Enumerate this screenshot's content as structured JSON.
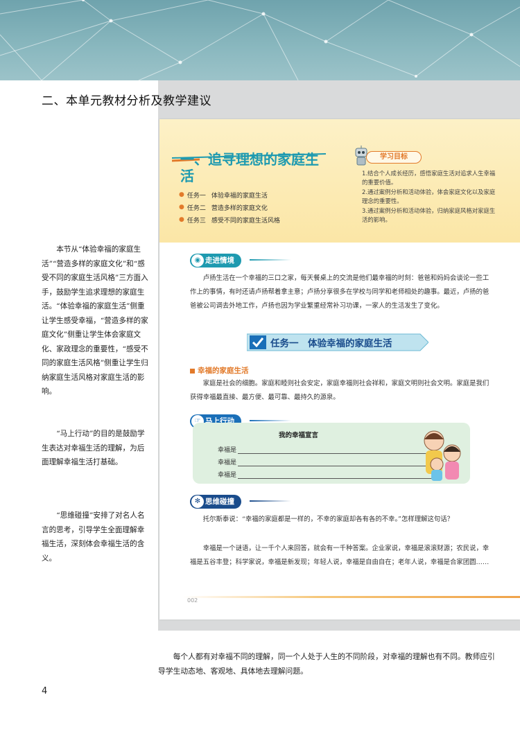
{
  "section_title": "二、本单元教材分析及教学建议",
  "textbook": {
    "lesson_title": "一、追寻理想的家庭生活",
    "tasks": [
      {
        "num": "任务一",
        "label": "体验幸福的家庭生活"
      },
      {
        "num": "任务二",
        "label": "营造多样的家庭文化"
      },
      {
        "num": "任务三",
        "label": "感受不同的家庭生活风格"
      }
    ],
    "goals_label": "学习目标",
    "goals": [
      "1.结合个人成长经历，感悟家庭生活对追求人生幸福的重要价值。",
      "2.通过案例分析和活动体验，体会家庭文化以及家庭理念的重要性。",
      "3.通过案例分析和活动体验，归纳家庭风格对家庭生活的影响。"
    ],
    "intro_badge": "走进情境",
    "intro_text": "卢扬生活在一个幸福的三口之家，每天餐桌上的交流是他们最幸福的时刻：爸爸和妈妈会谈论一些工作上的事情，有时还请卢扬帮着拿主意；卢扬分享很多在学校与同学和老师相处的趣事。最近，卢扬的爸爸被公司调去外地工作，卢扬也因为学业繁重经常补习功课，一家人的生活发生了变化。",
    "task_banner": "任务一　体验幸福的家庭生活",
    "subhead": "幸福的家庭生活",
    "para1": "家庭是社会的细胞。家庭和睦则社会安定，家庭幸福则社会祥和，家庭文明则社会文明。家庭是我们获得幸福最直接、最方便、最可靠、最持久的源泉。",
    "action_badge": "马上行动",
    "box_title": "我的幸福宣言",
    "fill_label": "幸福是",
    "think_badge": "思维碰撞",
    "think_text": "托尔斯泰说：“幸福的家庭都是一样的，不幸的家庭却各有各的不幸。”怎样理解这句话？",
    "para2": "幸福是一个谜语，让一千个人来回答，就会有一千种答案。企业家说，幸福是滚滚财源；农民说，幸福是五谷丰登；科学家说，幸福是新发现；年轻人说，幸福是自由自在；老年人说，幸福是合家团圆……",
    "page_small": "002"
  },
  "notes": {
    "note1": "本节从“体验幸福的家庭生活”“营造多样的家庭文化”和“感受不同的家庭生活风格”三方面入手，鼓励学生追求理想的家庭生活。“体验幸福的家庭生活”侧重让学生感受幸福，“营造多样的家庭文化”侧重让学生体会家庭文化、家政理念的重要性，“感受不同的家庭生活风格”侧重让学生归纳家庭生活风格对家庭生活的影响。",
    "note2": "“马上行动”的目的是鼓励学生表达对幸福生活的理解，为后面理解幸福生活打基础。",
    "note3": "“思维碰撞”安排了对名人名言的思考，引导学生全面理解幸福生活，深刻体会幸福生活的含义。"
  },
  "bottom_text": "每个人都有对幸福不同的理解，同一个人处于人生的不同阶段，对幸福的理解也有不同。教师应引导学生动态地、客观地、具体地去理解问题。",
  "page_number": "4",
  "colors": {
    "banner": "#7fb0b8",
    "teal": "#1e9ab0",
    "orange": "#e27a2a",
    "navy": "#1a4c8c",
    "green_box": "#dff0e0"
  }
}
